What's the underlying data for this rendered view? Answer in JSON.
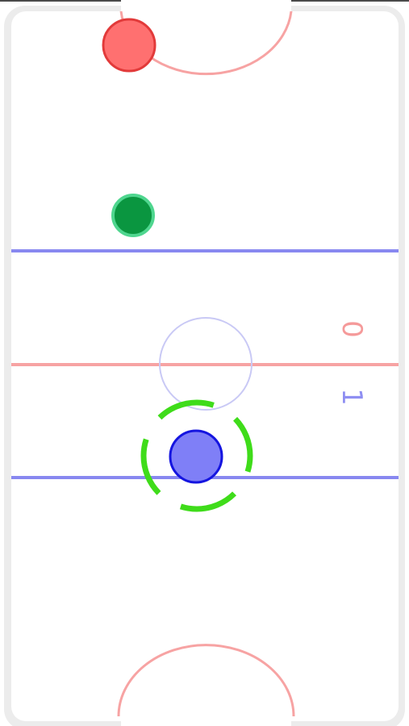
{
  "scores": {
    "red": "0",
    "blue": "1"
  },
  "colors": {
    "rink_border": "#ececec",
    "rink_surface": "#ffffff",
    "red_line": "#f7a3a3",
    "blue_line": "#8888f0",
    "red_goal_arc": "#f7a3a3",
    "red_paddle": "#ff7070",
    "red_paddle_rim": "#e23a3a",
    "blue_paddle": "#7f7ff7",
    "blue_paddle_rim": "#1515e0",
    "puck": "#0a9640",
    "puck_rim": "#4fd68f",
    "touch_indicator": "#3fdc1a",
    "center_circle": "#c9c9f5"
  },
  "icons": {
    "red_paddle": "red-mallet",
    "blue_paddle": "blue-mallet",
    "puck": "puck",
    "touch_ring": "dashed-ring"
  }
}
